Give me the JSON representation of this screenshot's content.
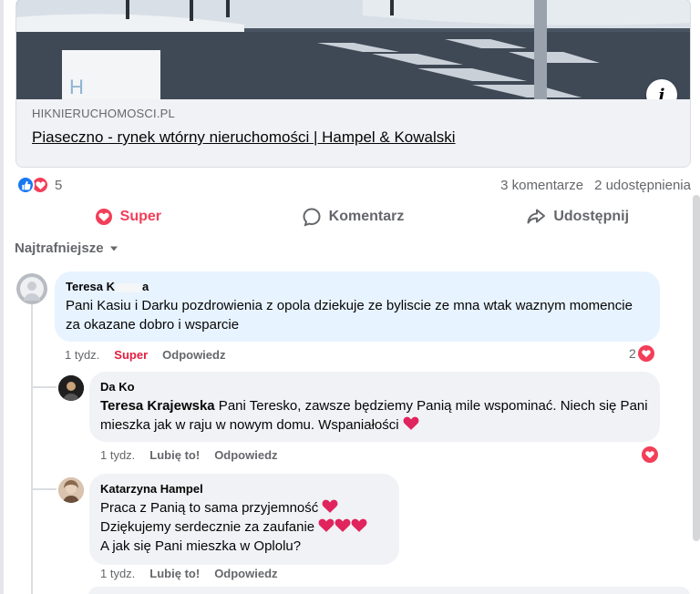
{
  "link_card": {
    "domain": "HIKNIERUCHOMOSCI.PL",
    "title": "Piaseczno - rynek wtórny nieruchomości | Hampel & Kowalski",
    "info_glyph": "i"
  },
  "reactions": {
    "icons": [
      "like-icon",
      "love-icon"
    ],
    "count": "5",
    "comments": "3 komentarze",
    "shares": "2 udostępnienia"
  },
  "actions": {
    "super": "Super",
    "comment": "Komentarz",
    "share": "Udostępnij"
  },
  "sort_label": "Najtrafniejsze",
  "comments": [
    {
      "author_start": "Teresa K",
      "author_end": "a",
      "text": "Pani Kasiu i Darku pozdrowienia z opola dziekuje ze byliscie ze mna wtak waznym momencie za okazane dobro i wsparcie",
      "time": "1 tydz.",
      "reaction_label": "Super",
      "reply_label": "Odpowiedz",
      "reaction_count": "2"
    }
  ],
  "replies": [
    {
      "author": "Da Ko",
      "mention": "Teresa Krajewska",
      "text": " Pani Teresko, zawsze będziemy Panią mile wspominać. Niech się Pani mieszka jak w raju w nowym domu. Wspaniałości ",
      "time": "1 tydz.",
      "like_label": "Lubię to!",
      "reply_label": "Odpowiedz"
    },
    {
      "author": "Katarzyna Hampel",
      "lines": [
        "Praca z Panią to sama przyjemność ",
        "Dziękujemy serdecznie za zaufanie ",
        "A jak się Pani mieszka w Oplolu?"
      ],
      "time": "1 tydz.",
      "like_label": "Lubię to!",
      "reply_label": "Odpowiedz"
    }
  ],
  "colors": {
    "like_blue": "#1877f2",
    "love_red": "#f33e58",
    "secondary_text": "#65676b",
    "bubble_bg": "#f0f2f5"
  }
}
